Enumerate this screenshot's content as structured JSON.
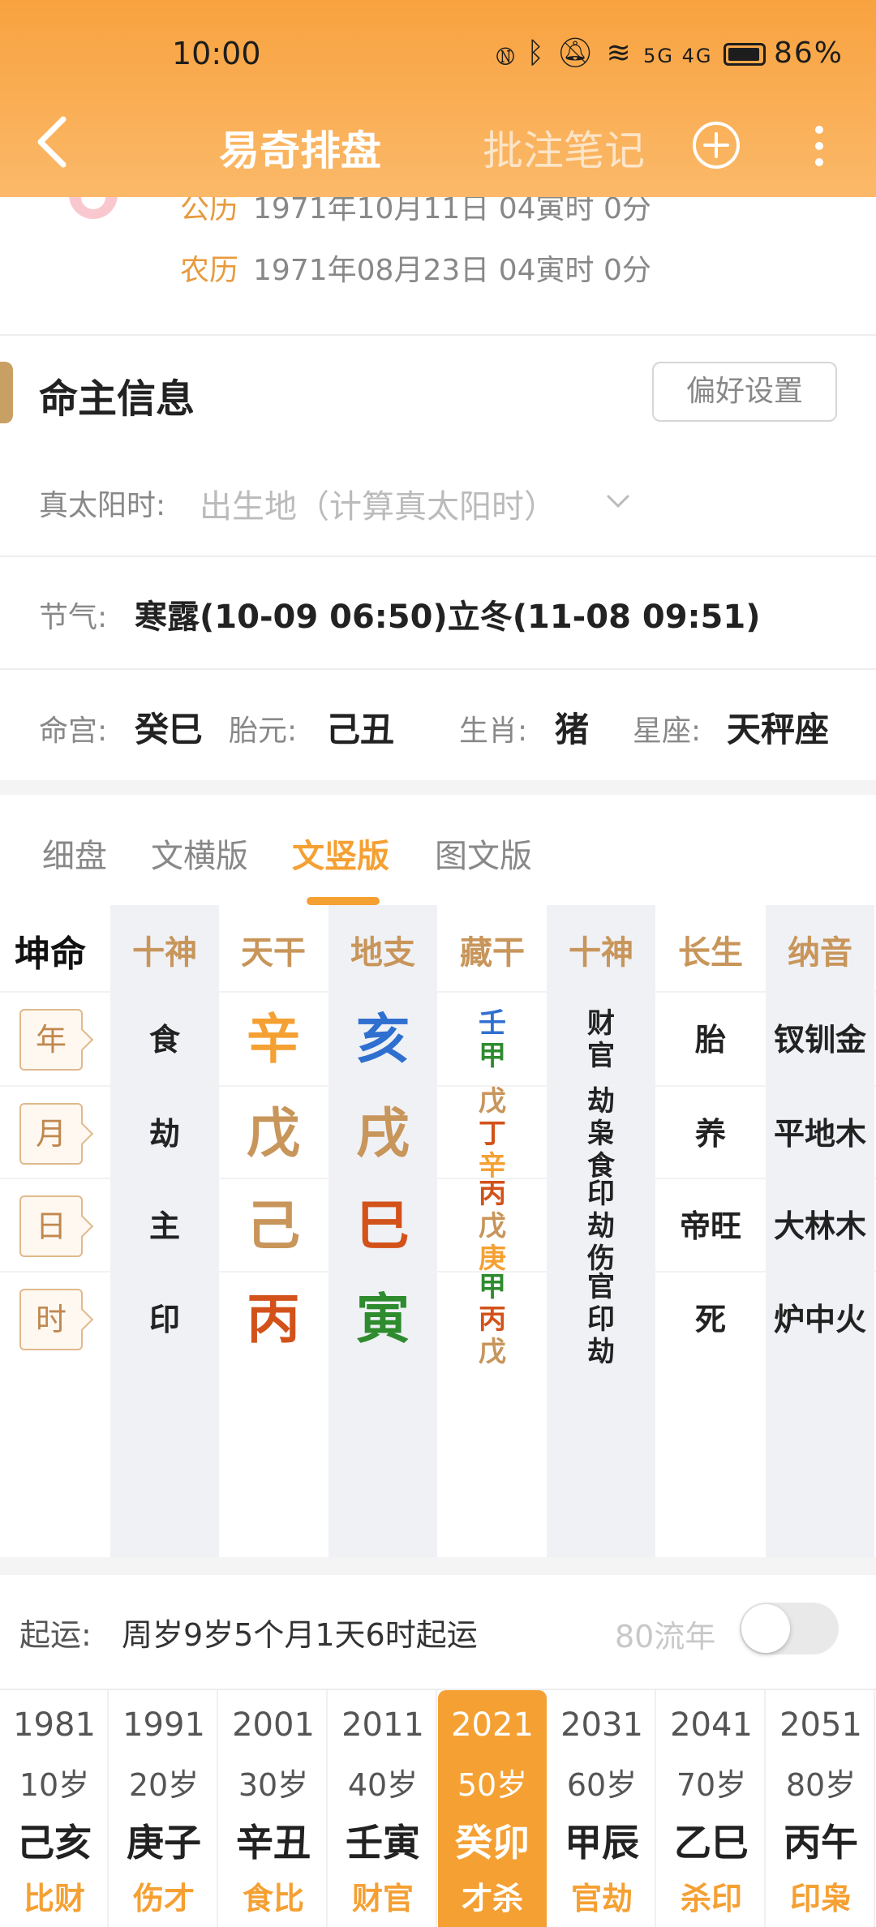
{
  "status": {
    "time": "10:00",
    "battery": "86%",
    "signal": "5G 4G"
  },
  "nav": {
    "title": "易奇排盘",
    "notes": "批注笔记"
  },
  "profile": {
    "solar_label": "公历",
    "solar_value": "1971年10月11日 04寅时 0分",
    "lunar_label": "农历",
    "lunar_value": "1971年08月23日 04寅时 0分"
  },
  "section": {
    "title": "命主信息",
    "pref_button": "偏好设置"
  },
  "info": {
    "true_solar_label": "真太阳时:",
    "true_solar_placeholder": "出生地（计算真太阳时）",
    "jieqi_label": "节气:",
    "jieqi_value": "寒露(10-09 06:50)立冬(11-08 09:51)",
    "minggong_label": "命宫:",
    "minggong_value": "癸巳",
    "taiyuan_label": "胎元:",
    "taiyuan_value": "己丑",
    "shengxiao_label": "生肖:",
    "shengxiao_value": "猪",
    "xingzuo_label": "星座:",
    "xingzuo_value": "天秤座"
  },
  "tabs": [
    {
      "label": "细盘"
    },
    {
      "label": "文横版"
    },
    {
      "label": "文竖版"
    },
    {
      "label": "图文版"
    }
  ],
  "active_tab": 2,
  "grid": {
    "corner": "坤命",
    "headers": [
      "十神",
      "天干",
      "地支",
      "藏干",
      "十神",
      "长生",
      "纳音"
    ],
    "rows": [
      {
        "pillar": "年",
        "shishen": "食",
        "tiangan": "辛",
        "dizhi": "亥",
        "canggan": [
          "壬",
          "甲"
        ],
        "canggan_colors": [
          "#2f6fcf",
          "#2e8b2e"
        ],
        "shishen2": [
          "财",
          "官"
        ],
        "changsheng": "胎",
        "nayin": "钗钏金",
        "tg_color": "#f5a033",
        "dz_color": "#2f6fcf"
      },
      {
        "pillar": "月",
        "shishen": "劫",
        "tiangan": "戊",
        "dizhi": "戌",
        "canggan": [
          "戊",
          "丁",
          "辛"
        ],
        "canggan_colors": [
          "#c8955a",
          "#d2521a",
          "#f5a033"
        ],
        "shishen2": [
          "劫",
          "枭",
          "食"
        ],
        "changsheng": "养",
        "nayin": "平地木",
        "tg_color": "#c8955a",
        "dz_color": "#c8955a"
      },
      {
        "pillar": "日",
        "shishen": "主",
        "tiangan": "己",
        "dizhi": "巳",
        "canggan": [
          "丙",
          "戊",
          "庚"
        ],
        "canggan_colors": [
          "#d2521a",
          "#c8955a",
          "#f5a033"
        ],
        "shishen2": [
          "印",
          "劫",
          "伤"
        ],
        "changsheng": "帝旺",
        "nayin": "大林木",
        "tg_color": "#c8955a",
        "dz_color": "#d2521a"
      },
      {
        "pillar": "时",
        "shishen": "印",
        "tiangan": "丙",
        "dizhi": "寅",
        "canggan": [
          "甲",
          "丙",
          "戊"
        ],
        "canggan_colors": [
          "#2e8b2e",
          "#d2521a",
          "#c8955a"
        ],
        "shishen2": [
          "官",
          "印",
          "劫"
        ],
        "changsheng": "死",
        "nayin": "炉中火",
        "tg_color": "#d2521a",
        "dz_color": "#2e8b2e"
      }
    ]
  },
  "qiyun": {
    "label": "起运:",
    "value": "周岁9岁5个月1天6时起运",
    "liunian_label": "80流年",
    "toggle_on": false
  },
  "dayun": [
    {
      "year": "1981",
      "age": "10岁",
      "ganzhi": "己亥",
      "shishen": "比财"
    },
    {
      "year": "1991",
      "age": "20岁",
      "ganzhi": "庚子",
      "shishen": "伤才"
    },
    {
      "year": "2001",
      "age": "30岁",
      "ganzhi": "辛丑",
      "shishen": "食比"
    },
    {
      "year": "2011",
      "age": "40岁",
      "ganzhi": "壬寅",
      "shishen": "财官"
    },
    {
      "year": "2021",
      "age": "50岁",
      "ganzhi": "癸卯",
      "shishen": "才杀"
    },
    {
      "year": "2031",
      "age": "60岁",
      "ganzhi": "甲辰",
      "shishen": "官劫"
    },
    {
      "year": "2041",
      "age": "70岁",
      "ganzhi": "乙巳",
      "shishen": "杀印"
    },
    {
      "year": "2051",
      "age": "80岁",
      "ganzhi": "丙午",
      "shishen": "印枭"
    }
  ],
  "active_dayun": 4,
  "colors": {
    "accent": "#f5a033",
    "header": "#f8a23f",
    "gold": "#c8955a"
  }
}
